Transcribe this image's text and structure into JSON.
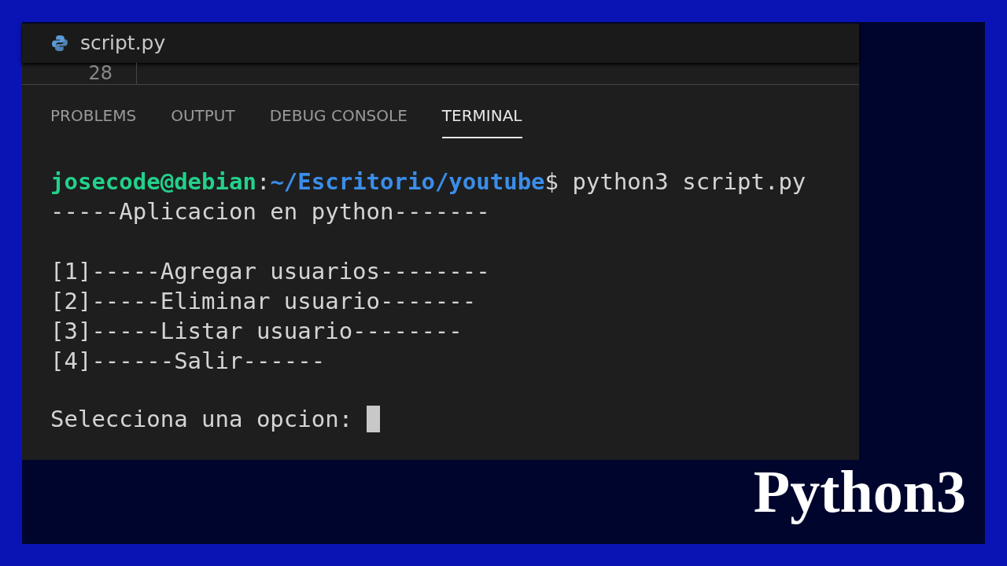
{
  "editor_tab": {
    "title": "script.py"
  },
  "line_number": "28",
  "panel_tabs": [
    {
      "label": "PROBLEMS",
      "selected": false
    },
    {
      "label": "OUTPUT",
      "selected": false
    },
    {
      "label": "DEBUG CONSOLE",
      "selected": false
    },
    {
      "label": "TERMINAL",
      "selected": true
    }
  ],
  "terminal": {
    "prompt": {
      "user": "josecode@debian",
      "separator": ":",
      "path": "~/Escritorio/youtube",
      "command": "$ python3 script.py"
    },
    "blocks": [
      [
        "-----Aplicacion en python-------"
      ],
      [
        "[1]-----Agregar usuarios--------",
        "[2]-----Eliminar usuario-------",
        "[3]-----Listar usuario--------",
        "[4]------Salir------"
      ]
    ],
    "input_prompt": "Selecciona una opcion: ",
    "cursor": true
  },
  "caption": "Python3"
}
